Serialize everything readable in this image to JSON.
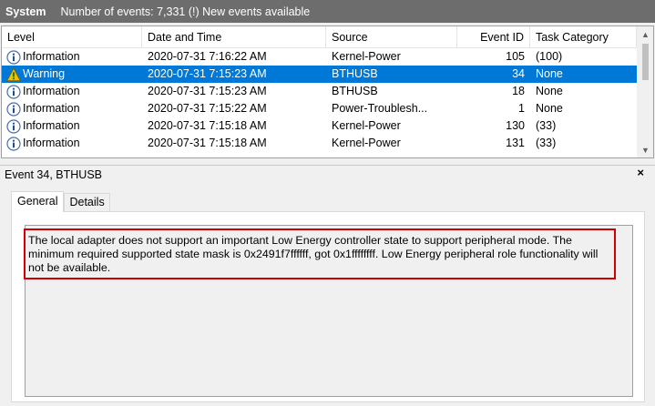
{
  "titlebar": {
    "name": "System",
    "count": "Number of events: 7,331 (!) New events available"
  },
  "grid": {
    "headers": {
      "level": "Level",
      "datetime": "Date and Time",
      "source": "Source",
      "event_id": "Event ID",
      "task": "Task Category"
    },
    "rows": [
      {
        "level": "Information",
        "datetime": "2020-07-31 7:16:22 AM",
        "source": "Kernel-Power",
        "event_id": "105",
        "task": "(100)",
        "icon": "info-icon"
      },
      {
        "level": "Warning",
        "datetime": "2020-07-31 7:15:23 AM",
        "source": "BTHUSB",
        "event_id": "34",
        "task": "None",
        "icon": "warning-icon",
        "selected": true
      },
      {
        "level": "Information",
        "datetime": "2020-07-31 7:15:23 AM",
        "source": "BTHUSB",
        "event_id": "18",
        "task": "None",
        "icon": "info-icon"
      },
      {
        "level": "Information",
        "datetime": "2020-07-31 7:15:22 AM",
        "source": "Power-Troublesh...",
        "event_id": "1",
        "task": "None",
        "icon": "info-icon"
      },
      {
        "level": "Information",
        "datetime": "2020-07-31 7:15:18 AM",
        "source": "Kernel-Power",
        "event_id": "130",
        "task": "(33)",
        "icon": "info-icon"
      },
      {
        "level": "Information",
        "datetime": "2020-07-31 7:15:18 AM",
        "source": "Kernel-Power",
        "event_id": "131",
        "task": "(33)",
        "icon": "info-icon"
      }
    ]
  },
  "detail": {
    "title": "Event 34, BTHUSB",
    "close": "×",
    "tabs": {
      "general": "General",
      "details": "Details"
    },
    "message": "The local adapter does not support an important Low Energy controller state to support peripheral mode.  The minimum required supported state mask is 0x2491f7ffffff, got 0x1ffffffff.  Low Energy peripheral role functionality will not be available."
  },
  "colors": {
    "selection": "#0078d7",
    "titlebar": "#6d6d6d",
    "highlight_border": "#d10000"
  }
}
